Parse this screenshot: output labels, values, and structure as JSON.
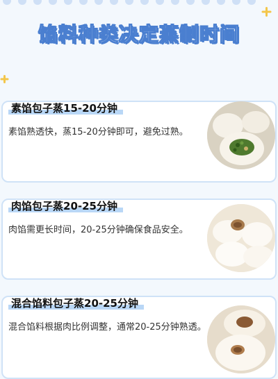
{
  "title": "馅料种类决定蒸制时间",
  "cards": [
    {
      "heading": "素馅包子蒸15-20分钟",
      "body": "素馅熟透快，蒸15-20分钟即可，避免过熟。",
      "image": "vegetable-bun-photo"
    },
    {
      "heading": "肉馅包子蒸20-25分钟",
      "body": "肉馅需更长时间，20-25分钟确保食品安全。",
      "image": "meat-bun-photo"
    },
    {
      "heading": "混合馅料包子蒸20-25分钟",
      "body": "混合馅料根据肉比例调整，通常20-25分钟熟透。",
      "image": "mixed-bun-photo"
    }
  ],
  "colors": {
    "title_outline": "#4a7fd0",
    "card_border": "#cfe2f7",
    "highlight": "#b9d7f6",
    "accent_star": "#f3c64a"
  }
}
